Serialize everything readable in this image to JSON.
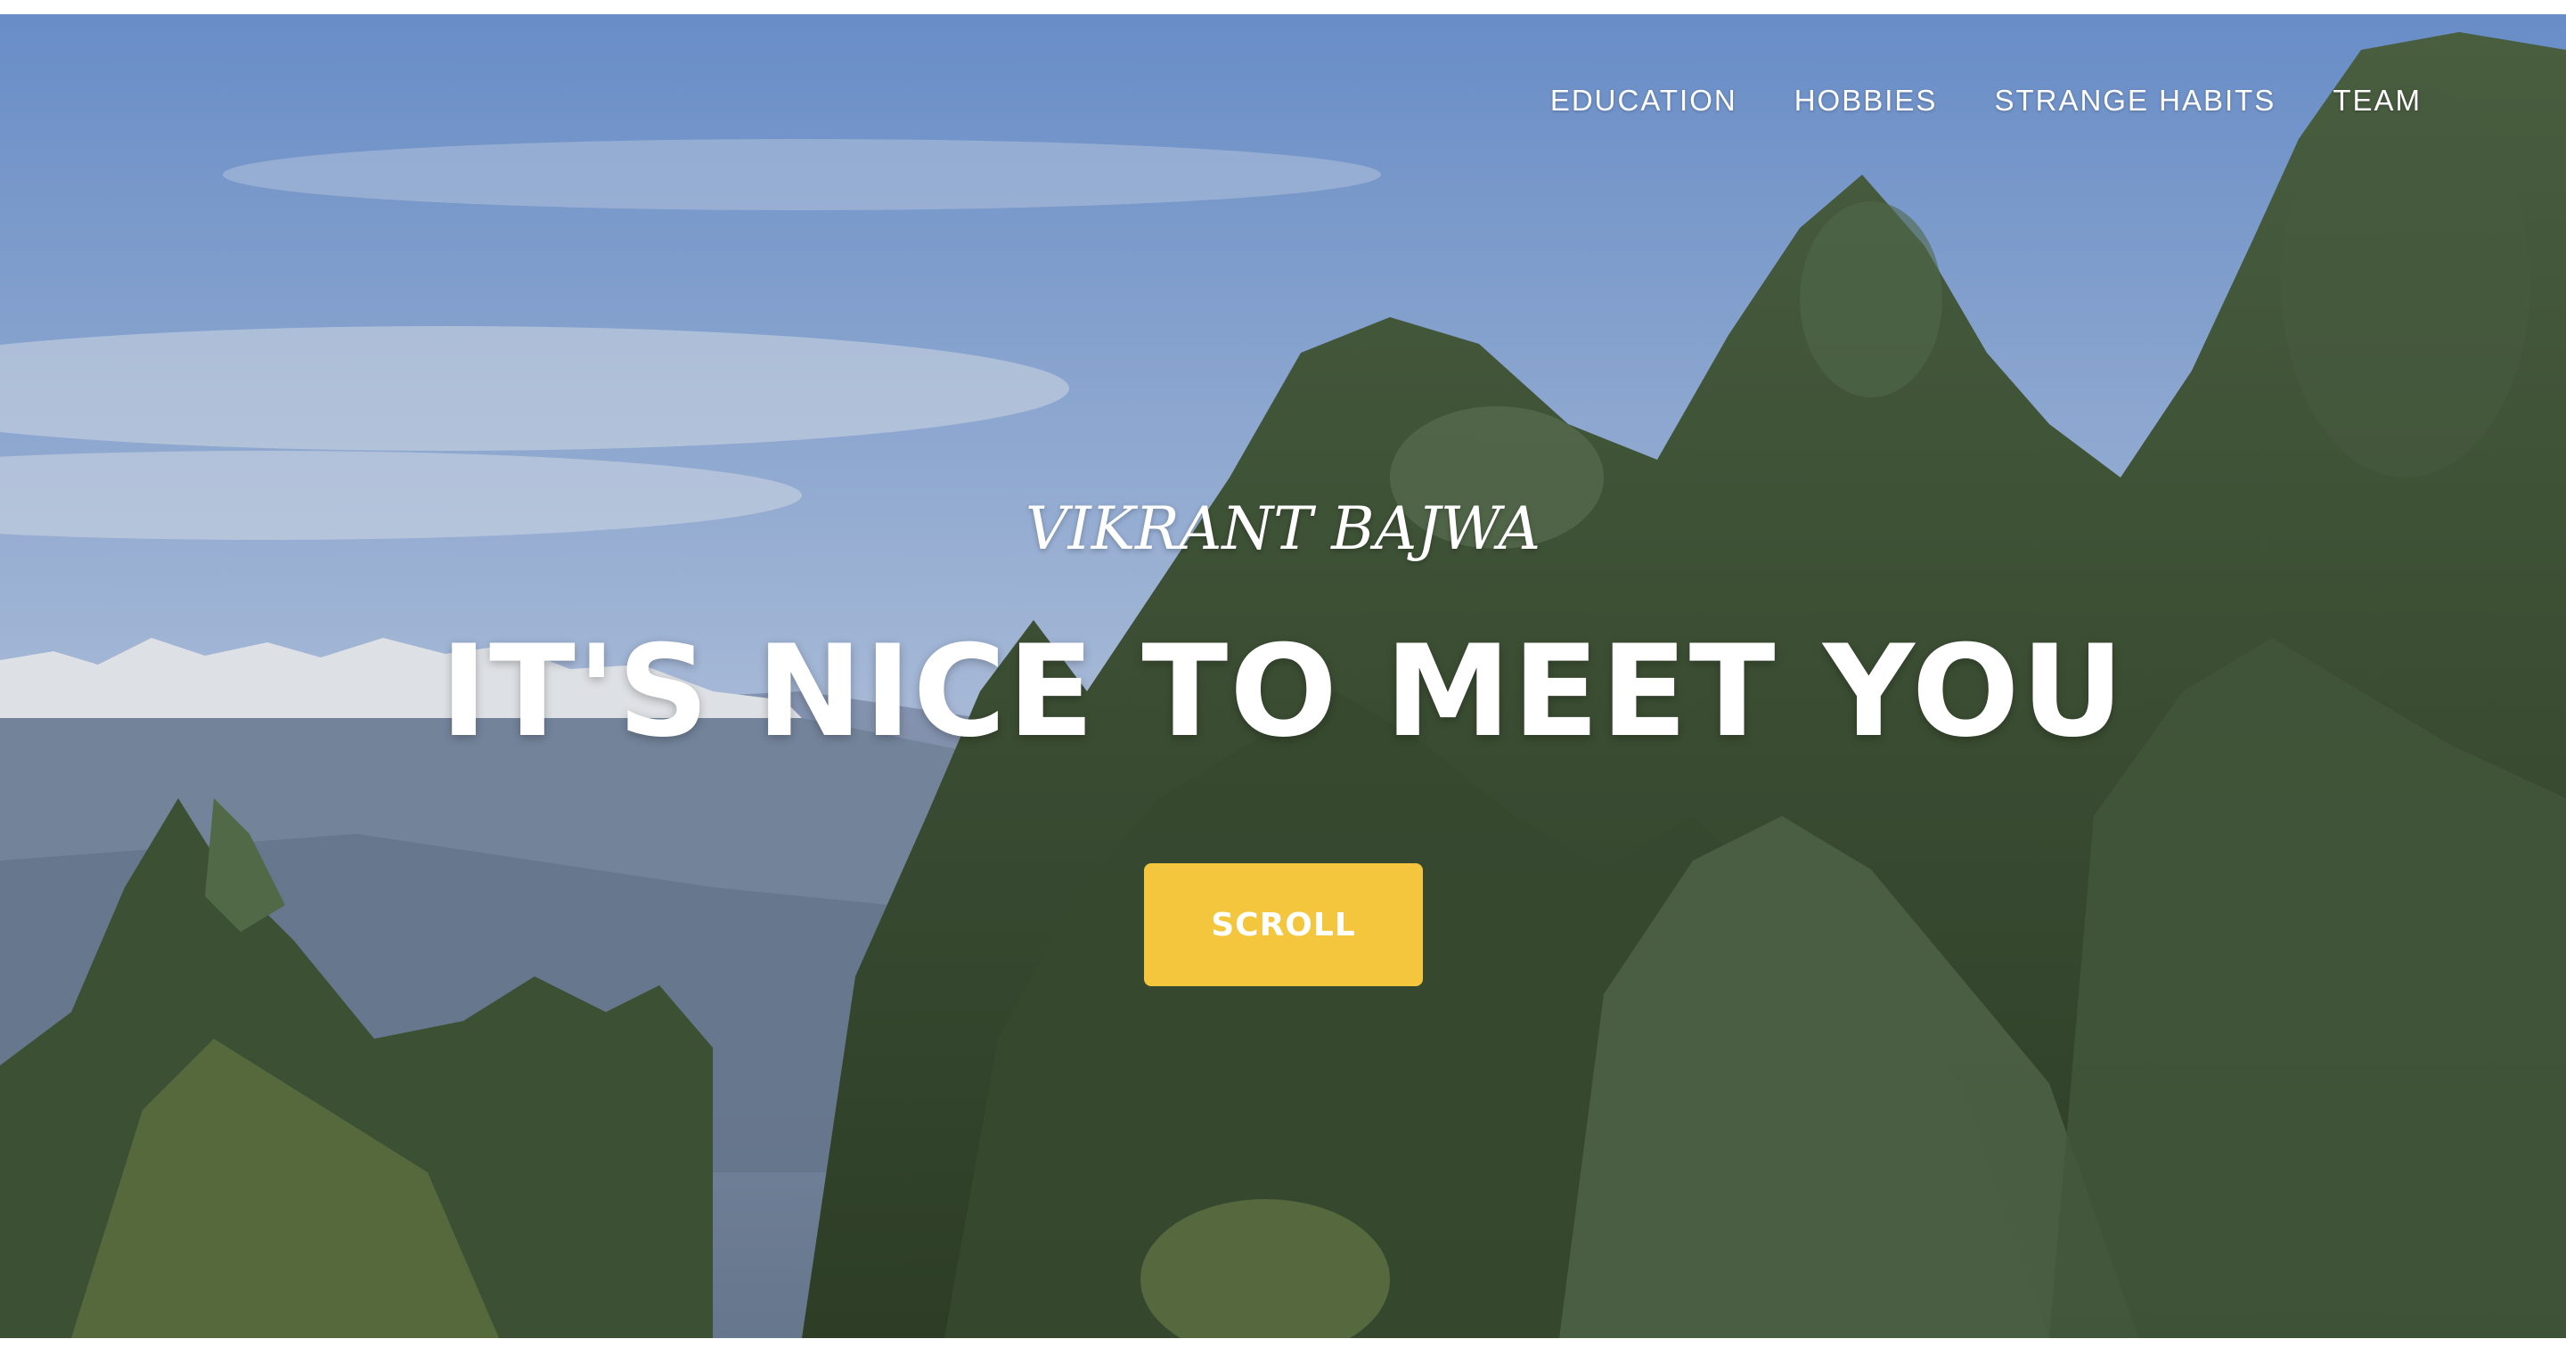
{
  "nav": {
    "items": [
      {
        "label": "EDUCATION"
      },
      {
        "label": "HOBBIES"
      },
      {
        "label": "STRANGE HABITS"
      },
      {
        "label": "TEAM"
      }
    ]
  },
  "hero": {
    "subheading": "VIKRANT BAJWA",
    "heading": "IT'S NICE TO MEET YOU",
    "button_label": "SCROLL",
    "background": "mountain-forest-photo"
  },
  "colors": {
    "accent": "#f4c63e",
    "text": "#ffffff",
    "sky": "#7fa3d8",
    "forest": "#3e5535"
  }
}
